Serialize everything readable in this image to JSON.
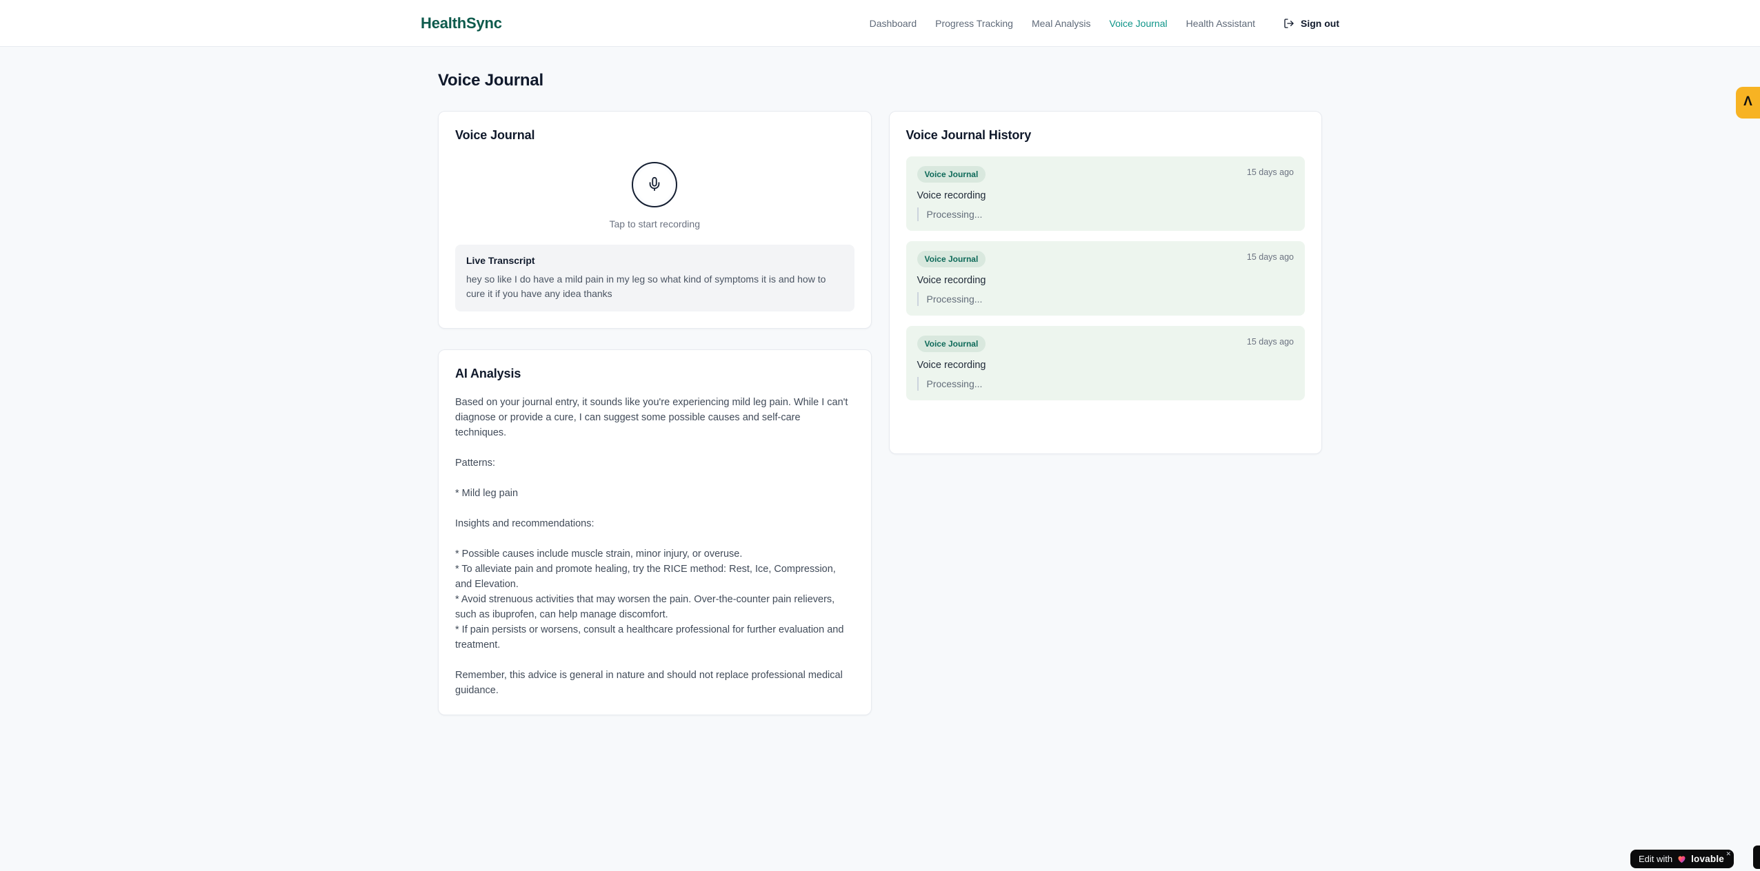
{
  "header": {
    "brand": "HealthSync",
    "nav": [
      {
        "label": "Dashboard"
      },
      {
        "label": "Progress Tracking"
      },
      {
        "label": "Meal Analysis"
      },
      {
        "label": "Voice Journal"
      },
      {
        "label": "Health Assistant"
      }
    ],
    "sign_out_label": "Sign out"
  },
  "page": {
    "title": "Voice Journal"
  },
  "recorder_card": {
    "title": "Voice Journal",
    "tap_hint": "Tap to start recording",
    "transcript_title": "Live Transcript",
    "transcript_text": "hey so like I do have a mild pain in my leg so what kind of symptoms it is and how to cure it if you have any idea thanks"
  },
  "analysis_card": {
    "title": "AI Analysis",
    "blocks": [
      "Based on your journal entry, it sounds like you're experiencing mild leg pain. While I can't diagnose or provide a cure, I can suggest some possible causes and self-care techniques.",
      "Patterns:",
      "* Mild leg pain",
      "Insights and recommendations:",
      "* Possible causes include muscle strain, minor injury, or overuse.",
      "* To alleviate pain and promote healing, try the RICE method: Rest, Ice, Compression, and Elevation.",
      "* Avoid strenuous activities that may worsen the pain. Over-the-counter pain relievers, such as ibuprofen, can help manage discomfort.",
      "* If pain persists or worsens, consult a healthcare professional for further evaluation and treatment.",
      "Remember, this advice is general in nature and should not replace professional medical guidance."
    ]
  },
  "history_card": {
    "title": "Voice Journal History",
    "entries": [
      {
        "badge": "Voice Journal",
        "time": "15 days ago",
        "label": "Voice recording",
        "status": "Processing..."
      },
      {
        "badge": "Voice Journal",
        "time": "15 days ago",
        "label": "Voice recording",
        "status": "Processing..."
      },
      {
        "badge": "Voice Journal",
        "time": "15 days ago",
        "label": "Voice recording",
        "status": "Processing..."
      }
    ]
  },
  "overlays": {
    "edge_badge_glyph": "Λ",
    "edit_badge_prefix": "Edit with",
    "edit_badge_brand": "lovable",
    "edit_badge_close": "✕"
  },
  "colors": {
    "brand_green": "#0d5a4c",
    "nav_active_teal": "#0d9488",
    "entry_bg_green": "#edf5ee",
    "badge_bg_green": "#d9e8de",
    "badge_text_green": "#0e6a59",
    "edge_badge_amber": "#f7b323",
    "pill_black": "#0b0b0c"
  }
}
